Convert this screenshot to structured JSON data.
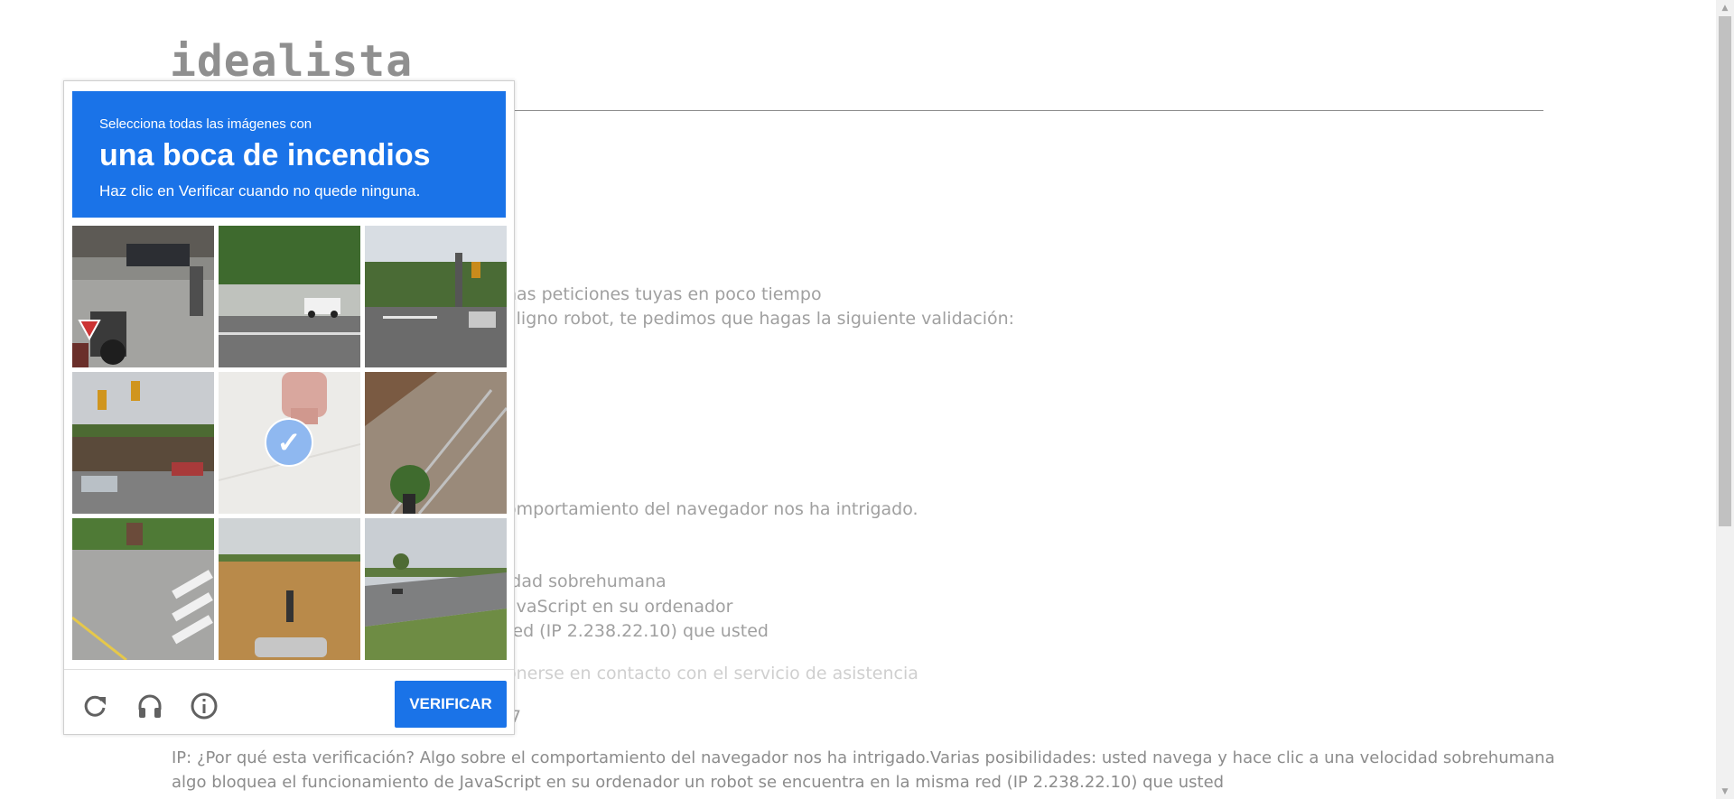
{
  "page": {
    "logo": "idealista",
    "lines": [
      "has peticiones tuyas en poco tiempo",
      "aligno robot, te pedimos que hagas la siguiente validación:",
      "omportamiento del navegador nos ha intrigado.",
      "idad sobrehumana",
      "avaScript en su ordenador",
      "red (IP 2.238.22.10) que usted",
      "onerse en contacto con el servicio de asistencia",
      "7",
      "IP: ¿Por qué esta verificación? Algo sobre el comportamiento del navegador nos ha intrigado.Varias posibilidades: usted navega y hace clic a una velocidad sobrehumana",
      "algo bloquea el funcionamiento de JavaScript en su ordenador un robot se encuentra en la misma red (IP 2.238.22.10) que usted"
    ]
  },
  "captcha": {
    "instruction_small": "Selecciona todas las imágenes con",
    "instruction_big": "una boca de incendios",
    "instruction_sub": "Haz clic en Verificar cuando no quede ninguna.",
    "verify_label": "VERIFICAR",
    "tiles": [
      {
        "name": "tile-street-motorcycle",
        "selected": false
      },
      {
        "name": "tile-road-truck",
        "selected": false
      },
      {
        "name": "tile-road-traffic-light",
        "selected": false
      },
      {
        "name": "tile-traffic-lights-parking",
        "selected": false
      },
      {
        "name": "tile-hydrant-closeup",
        "selected": true
      },
      {
        "name": "tile-stairs",
        "selected": false
      },
      {
        "name": "tile-crosswalk",
        "selected": false
      },
      {
        "name": "tile-field-car",
        "selected": false
      },
      {
        "name": "tile-highway-field",
        "selected": false
      }
    ],
    "accent_color": "#1a73e8"
  }
}
